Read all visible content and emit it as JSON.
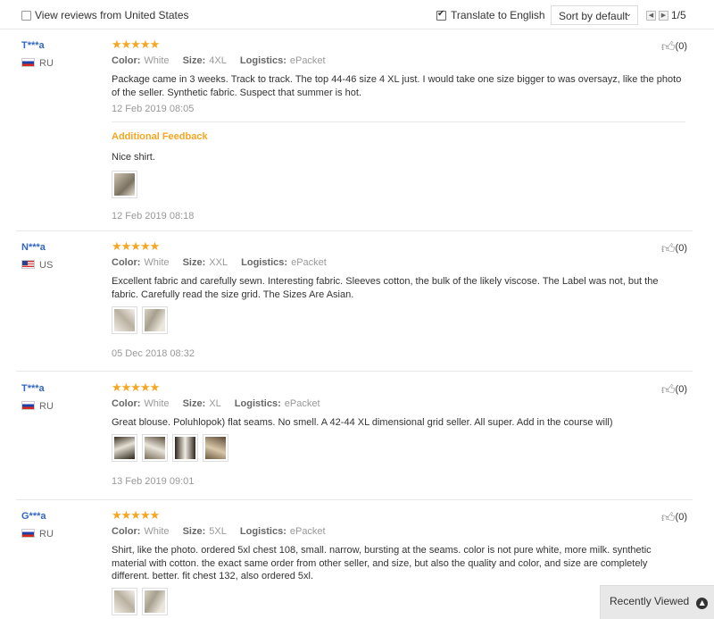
{
  "toolbar": {
    "view_local_label": "View reviews from United States",
    "translate_label": "Translate to English",
    "sort_label": "Sort by default",
    "page_indicator": "1/5"
  },
  "labels": {
    "color": "Color:",
    "size": "Size:",
    "logistics": "Logistics:",
    "additional_feedback": "Additional Feedback"
  },
  "reviews": [
    {
      "user": "T***a",
      "country": "RU",
      "color": "White",
      "size": "4XL",
      "logistics": "ePacket",
      "helpful": "(0)",
      "text": "Package came in 3 weeks. Track to track. The top 44-46 size 4 XL just. I would take one size bigger to was oversayz, like the photo of the seller. Synthetic fabric. Suspect that summer is hot.",
      "date": "12 Feb 2019 08:05",
      "additional_text": "Nice shirt.",
      "additional_date": "12 Feb 2019 08:18"
    },
    {
      "user": "N***a",
      "country": "US",
      "color": "White",
      "size": "XXL",
      "logistics": "ePacket",
      "helpful": "(0)",
      "text": "Excellent fabric and carefully sewn. Interesting fabric. Sleeves cotton, the bulk of the likely viscose. The Label was not, but the fabric. Carefully read the size grid. The Sizes Are Asian.",
      "date": "05 Dec 2018 08:32"
    },
    {
      "user": "T***a",
      "country": "RU",
      "color": "White",
      "size": "XL",
      "logistics": "ePacket",
      "helpful": "(0)",
      "text": "Great blouse. Poluhlopok) flat seams. No smell. A 42-44 XL dimensional grid seller. All super. Add in the course will)",
      "date": "13 Feb 2019 09:01"
    },
    {
      "user": "G***a",
      "country": "RU",
      "color": "White",
      "size": "5XL",
      "logistics": "ePacket",
      "helpful": "(0)",
      "text": "Shirt, like the photo. ordered 5xl chest 108, small. narrow, bursting at the seams. color is not pure white, more milk. synthetic material with cotton. the exact same order from other seller, and size, but also the quality and color, and size are completely different. better. fit chest 132, also ordered 5xl."
    }
  ],
  "recent": {
    "label": "Recently Viewed"
  },
  "colors": {
    "accent_star": "#f5a623",
    "user_link": "#3367c1"
  }
}
